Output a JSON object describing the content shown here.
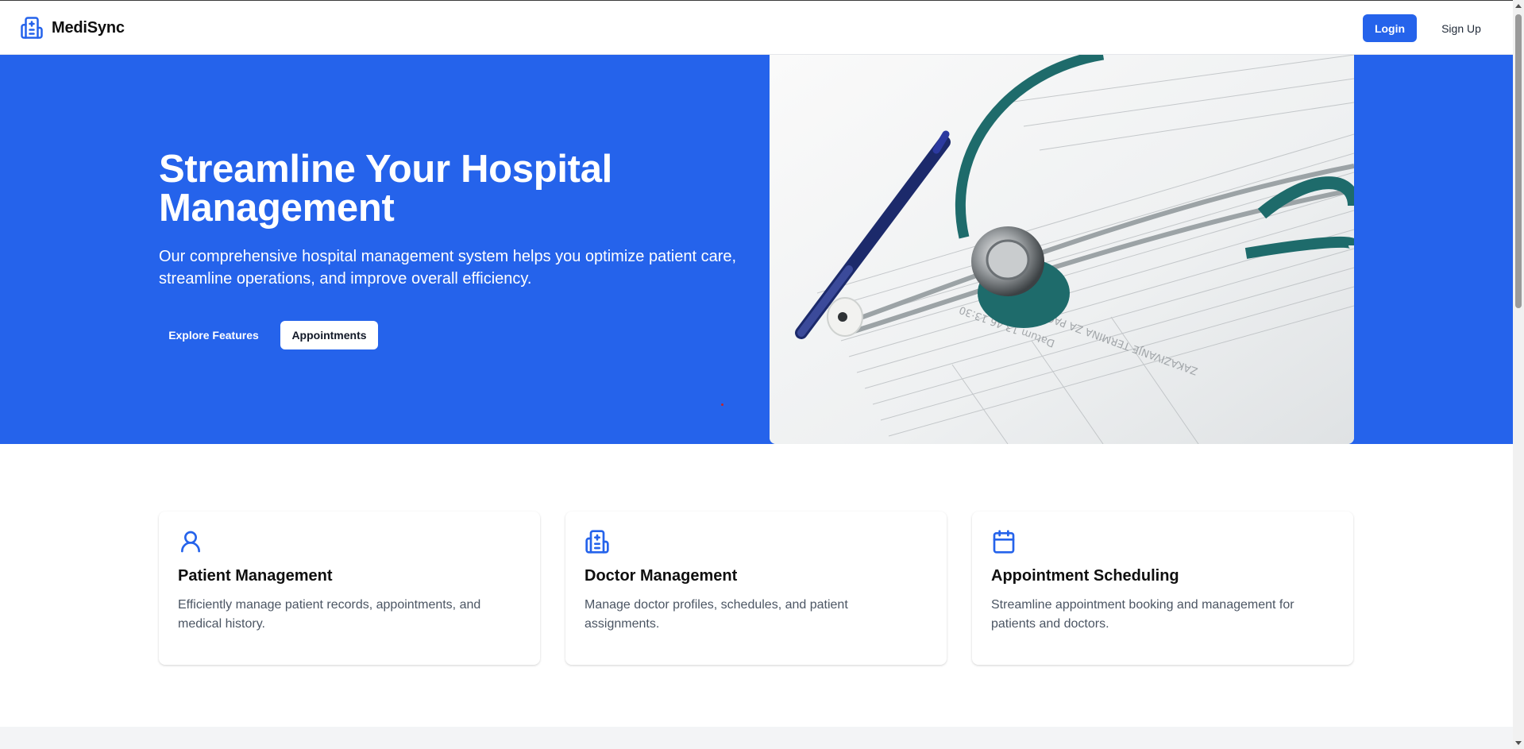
{
  "brand": {
    "name": "MediSync",
    "icon": "hospital-icon"
  },
  "header": {
    "login_label": "Login",
    "signup_label": "Sign Up"
  },
  "hero": {
    "title": "Streamline Your Hospital Management",
    "subtitle": "Our comprehensive hospital management system helps you optimize patient care, streamline operations, and improve overall efficiency.",
    "explore_label": "Explore Features",
    "appointments_label": "Appointments",
    "image": "stethoscope-on-medical-form-image"
  },
  "features": [
    {
      "icon": "user-icon",
      "title": "Patient Management",
      "description": "Efficiently manage patient records, appointments, and medical history."
    },
    {
      "icon": "hospital-icon",
      "title": "Doctor Management",
      "description": "Manage doctor profiles, schedules, and patient assignments."
    },
    {
      "icon": "calendar-icon",
      "title": "Appointment Scheduling",
      "description": "Streamline appointment booking and management for patients and doctors."
    }
  ],
  "colors": {
    "primary": "#2563eb",
    "text": "#0f0f0f",
    "muted": "#4b5563",
    "footer_bg": "#f3f4f6"
  }
}
